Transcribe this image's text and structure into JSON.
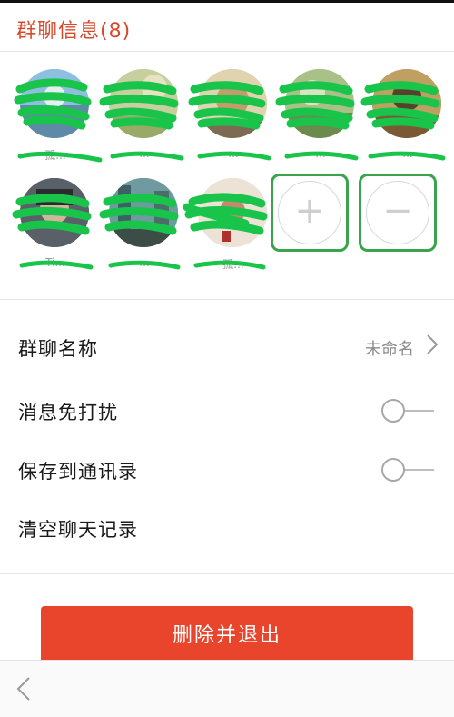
{
  "header": {
    "title": "群聊信息(8)"
  },
  "members": [
    {
      "name": "孤...",
      "color": "#6fa3c7"
    },
    {
      "name": "...",
      "color": "#b9c48c"
    },
    {
      "name": "...",
      "color": "#c9b58a"
    },
    {
      "name": "...",
      "color": "#8fae6e"
    },
    {
      "name": "...",
      "color": "#a88a4a"
    },
    {
      "name": "Ti...",
      "color": "#4a4f57"
    },
    {
      "name": "...",
      "color": "#5f8e7e"
    },
    {
      "name": "孤...",
      "color": "#d7c9b8"
    }
  ],
  "actions": {
    "add_symbol": "+",
    "remove_symbol": "−"
  },
  "settings": {
    "group_name_label": "群聊名称",
    "group_name_value": "未命名",
    "mute_label": "消息免打扰",
    "save_contacts_label": "保存到通讯录",
    "clear_history_label": "清空聊天记录"
  },
  "delete_button": {
    "label": "删除并退出"
  },
  "colors": {
    "accent": "#d9482b",
    "danger": "#e8452c",
    "highlight": "#3aa34b",
    "redaction": "#19c44a"
  }
}
